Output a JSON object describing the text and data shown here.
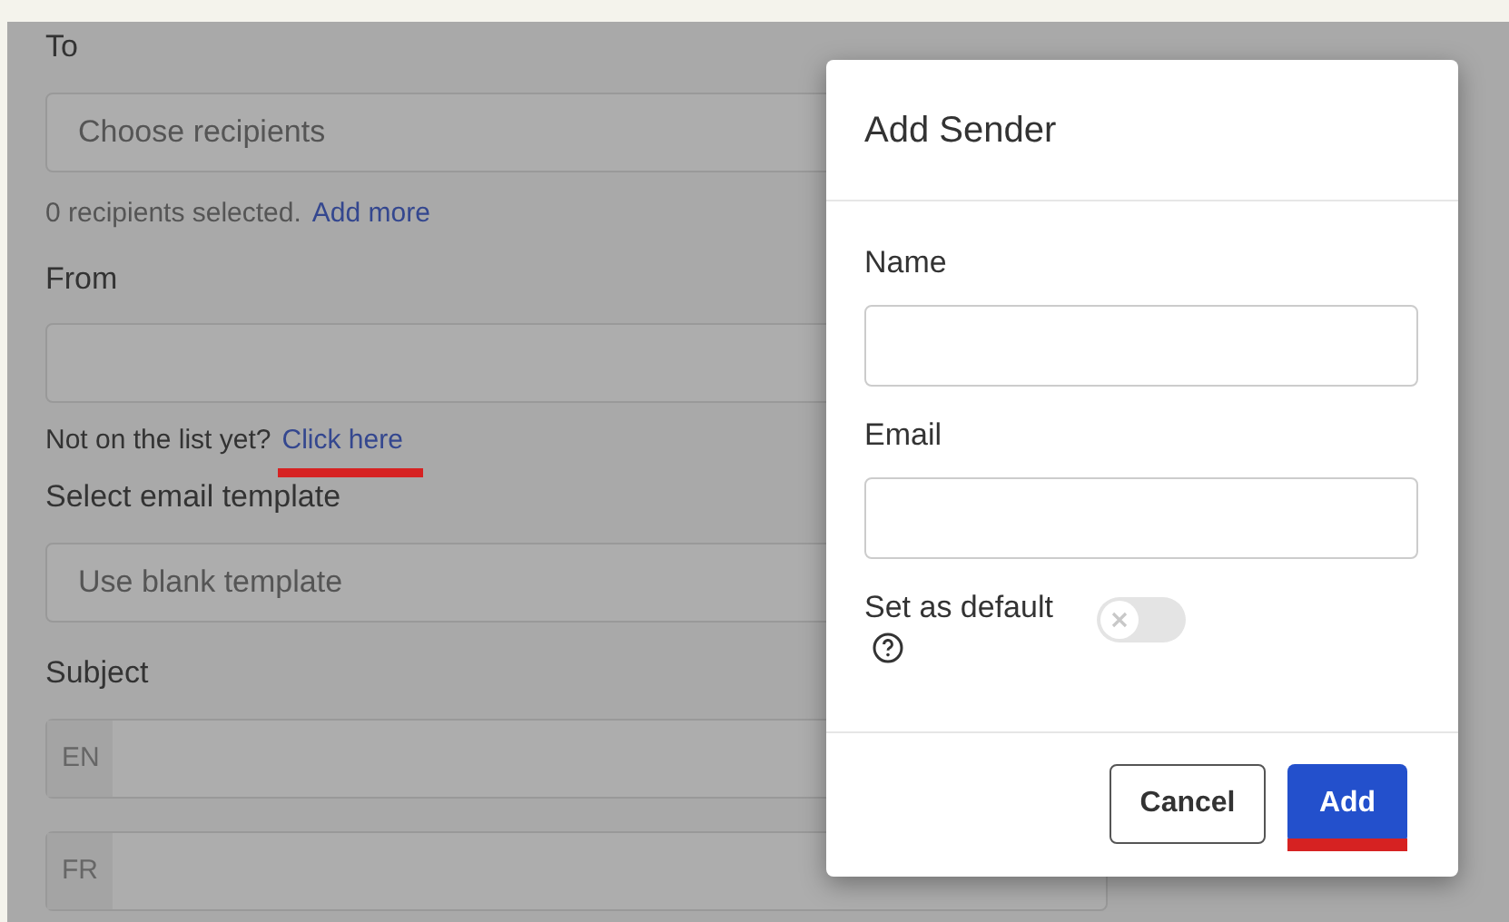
{
  "form": {
    "to": {
      "label": "To",
      "placeholder": "Choose recipients",
      "helper": "0 recipients selected.",
      "link": "Add more"
    },
    "from": {
      "label": "From",
      "helper": "Not on the list yet?",
      "link": "Click here",
      "link_marked": true
    },
    "template": {
      "label": "Select email template",
      "value": "Use blank template"
    },
    "subject": {
      "label": "Subject",
      "languages": [
        "EN",
        "FR"
      ]
    }
  },
  "dialog": {
    "title": "Add Sender",
    "fields": [
      {
        "label": "Name"
      },
      {
        "label": "Email"
      }
    ],
    "default": {
      "label": "Set as default",
      "on": false
    },
    "buttons": [
      {
        "label": "Cancel",
        "kind": "secondary",
        "marked": false
      },
      {
        "label": "Add",
        "kind": "primary",
        "marked": true
      }
    ]
  }
}
